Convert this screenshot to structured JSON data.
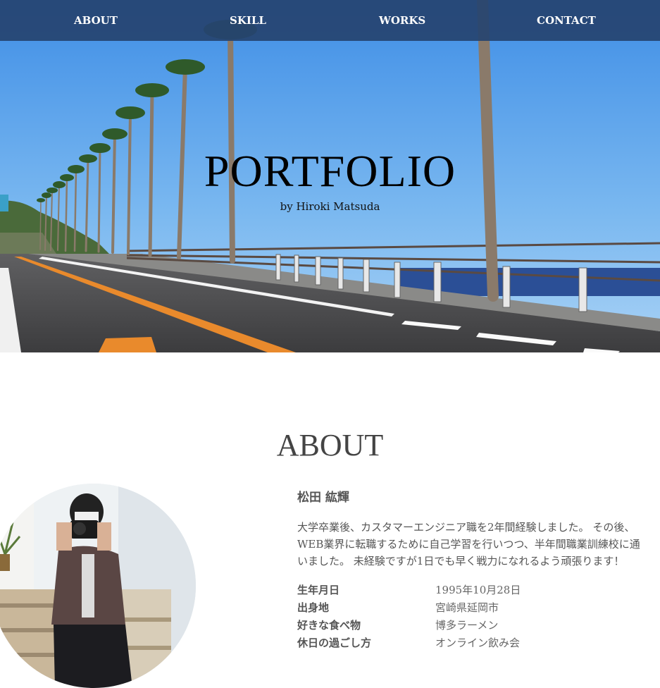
{
  "nav": {
    "items": [
      {
        "label": "ABOUT"
      },
      {
        "label": "SKILL"
      },
      {
        "label": "WORKS"
      },
      {
        "label": "CONTACT"
      }
    ]
  },
  "hero": {
    "title": "PORTFOLIO",
    "subtitle": "by Hiroki Matsuda"
  },
  "about": {
    "heading": "ABOUT",
    "name": "松田 紘輝",
    "intro_lines": [
      "大学卒業後、カスタマーエンジニア職を2年間経験しました。 その後、",
      "WEB業界に転職するために自己学習を行いつつ、半年間職業訓練校に通",
      "いました。 未経験ですが1日でも早く戦力になれるよう頑張ります！"
    ],
    "profile": [
      {
        "label": "生年月日",
        "value": "1995年10月28日"
      },
      {
        "label": "出身地",
        "value": "宮崎県延岡市"
      },
      {
        "label": "好きな食べ物",
        "value": "博多ラーメン"
      },
      {
        "label": "休日の過ごし方",
        "value": "オンライン飲み会"
      }
    ]
  },
  "colors": {
    "nav_bg": "#264470",
    "sky": "#6aa9e8",
    "road": "#4a4a4c",
    "sea": "#2b4f96"
  }
}
